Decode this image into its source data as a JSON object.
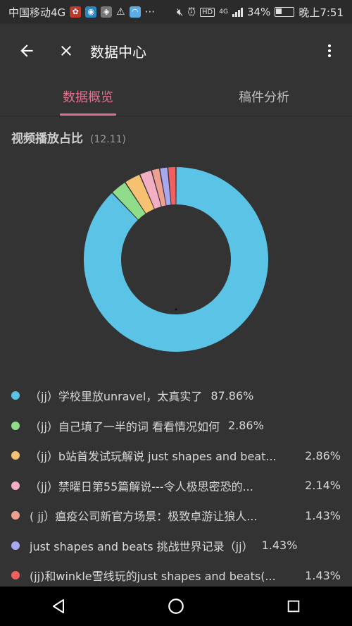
{
  "status_bar": {
    "carrier": "中国移动4G",
    "battery": "34%",
    "time": "晚上7:51",
    "network": "4G",
    "hd": "HD",
    "more": "···"
  },
  "app_bar": {
    "title": "数据中心"
  },
  "tabs": [
    {
      "label": "数据概览",
      "active": true
    },
    {
      "label": "稿件分析",
      "active": false
    }
  ],
  "section": {
    "title": "视频播放占比",
    "date": "(12.11)"
  },
  "chart_data": {
    "type": "pie",
    "donut": true,
    "categories": [
      "（jj）学校里放unravel，太真实了",
      "（jj）自己填了一半的词 看看情况如何",
      "（jj）b站首发试玩解说 just shapes and beat...",
      "（jj）禁曜日第55篇解说---令人极思密恐的...",
      "( jj）瘟疫公司新官方场景：极致卓游让狼人...",
      "just shapes and beats 挑战世界记录（jj）",
      "(jj)和winkle雪线玩的just shapes and beats(..."
    ],
    "values": [
      87.86,
      2.86,
      2.86,
      2.14,
      1.43,
      1.43,
      1.43
    ],
    "colors": [
      "#5bc4e6",
      "#8fdc8a",
      "#f6c170",
      "#f2aec3",
      "#f0a090",
      "#a8a8f0",
      "#f06060"
    ]
  },
  "legend": [
    {
      "label": "（jj）学校里放unravel，太真实了",
      "pct": "87.86%"
    },
    {
      "label": "（jj）自己填了一半的词 看看情况如何",
      "pct": "2.86%"
    },
    {
      "label": "（jj）b站首发试玩解说 just shapes and beat...",
      "pct": "2.86%"
    },
    {
      "label": "（jj）禁曜日第55篇解说---令人极思密恐的...",
      "pct": "2.14%"
    },
    {
      "label": "( jj）瘟疫公司新官方场景：极致卓游让狼人...",
      "pct": "1.43%"
    },
    {
      "label": "just shapes and beats 挑战世界记录（jj）",
      "pct": "1.43%"
    },
    {
      "label": "(jj)和winkle雪线玩的just shapes and beats(...",
      "pct": "1.43%"
    }
  ],
  "icons": {
    "back": "arrow-left-icon",
    "close": "close-icon",
    "more": "more-vertical-icon",
    "nav_back": "triangle-back-icon",
    "nav_home": "circle-home-icon",
    "nav_recent": "square-recent-icon"
  }
}
